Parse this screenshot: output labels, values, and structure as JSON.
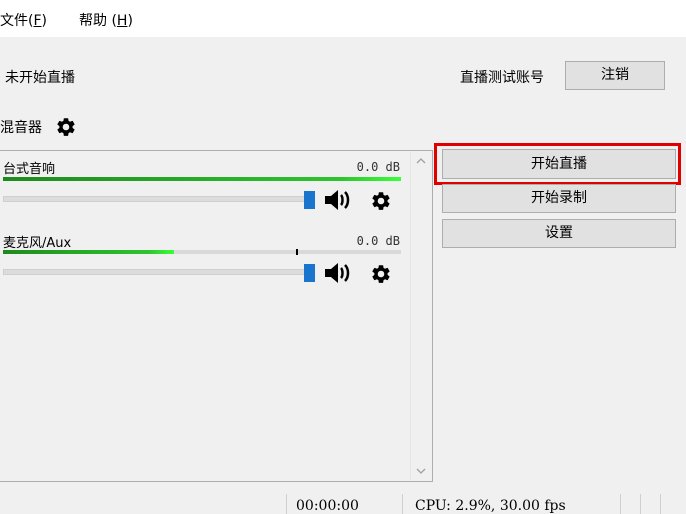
{
  "menu": {
    "file": {
      "label": "文件(",
      "mnemonic": "F",
      "close": ")"
    },
    "help": {
      "label": "帮助 (",
      "mnemonic": "H",
      "close": ")"
    }
  },
  "stream_status": "未开始直播",
  "account": {
    "label": "直播测试账号",
    "logout_label": "注销"
  },
  "mixer": {
    "title": "混音器",
    "channels": [
      {
        "name": "台式音响",
        "db": "0.0 dB",
        "level": 1.0
      },
      {
        "name": "麦克风/Aux",
        "db": "0.0 dB",
        "level": 0.43,
        "peak": 0.735
      }
    ]
  },
  "controls": {
    "start_stream_label": "开始直播",
    "start_record_label": "开始录制",
    "settings_label": "设置"
  },
  "statusbar": {
    "time": "00:00:00",
    "cpu": "CPU: 2.9%, 30.00 fps"
  },
  "colors": {
    "highlight": "#e00000",
    "slider_handle": "#1874cd",
    "meter_green": "#2ec42e"
  }
}
